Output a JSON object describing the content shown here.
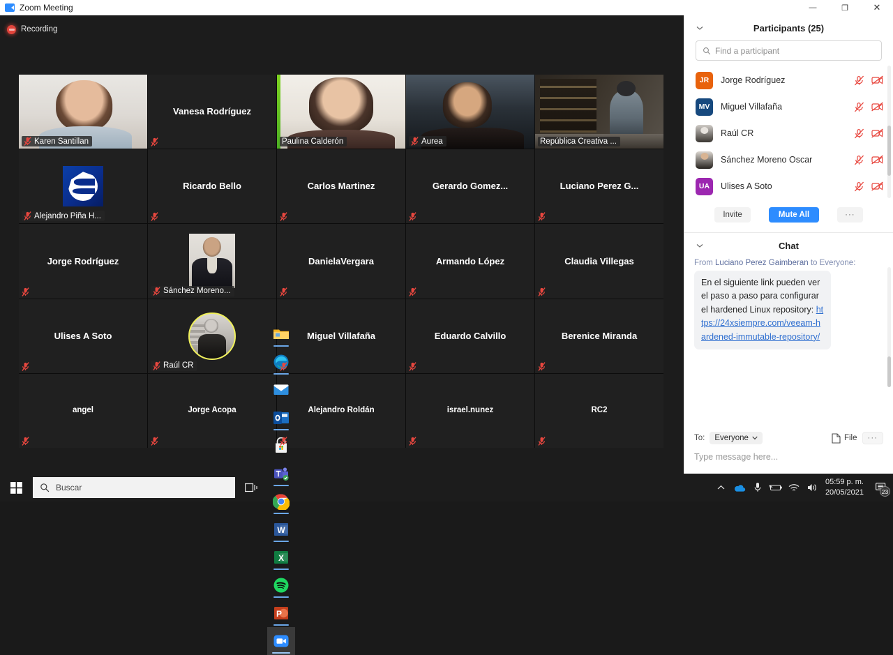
{
  "window": {
    "title": "Zoom Meeting",
    "icon": "zoom-video-icon",
    "minimize_label": "—",
    "restore_label": "❐",
    "close_label": "✕"
  },
  "meeting": {
    "recording_label": "Recording",
    "active_speaker": "Paulina Calderón",
    "tiles": [
      {
        "name": "Karen Santillan",
        "display": "corner",
        "video": "v-karen",
        "muted": true,
        "active": false
      },
      {
        "name": "Vanesa Rodríguez",
        "display": "center",
        "video": "",
        "muted": true,
        "active": false
      },
      {
        "name": "Paulina Calderón",
        "display": "corner",
        "video": "v-paulina",
        "muted": false,
        "active": true
      },
      {
        "name": "Aurea",
        "display": "corner",
        "video": "v-aurea",
        "muted": true,
        "active": false
      },
      {
        "name": "República Creativa ...",
        "display": "corner",
        "video": "v-republica",
        "muted": false,
        "active": false
      },
      {
        "name": "Alejandro Piña H...",
        "display": "corner",
        "avatar": "square-logo",
        "muted": true,
        "active": false
      },
      {
        "name": "Ricardo Bello",
        "display": "center",
        "video": "",
        "muted": true,
        "active": false
      },
      {
        "name": "Carlos Martinez",
        "display": "center",
        "video": "",
        "muted": true,
        "active": false
      },
      {
        "name": "Gerardo  Gomez...",
        "display": "center",
        "video": "",
        "muted": true,
        "active": false
      },
      {
        "name": "Luciano  Perez G...",
        "display": "center",
        "video": "",
        "muted": true,
        "active": false
      },
      {
        "name": "Jorge Rodríguez",
        "display": "center",
        "video": "",
        "muted": true,
        "active": false
      },
      {
        "name": "Sánchez Moreno...",
        "display": "corner",
        "avatar": "square-photo",
        "muted": true,
        "active": false
      },
      {
        "name": "DanielaVergara",
        "display": "center",
        "video": "",
        "muted": true,
        "active": false
      },
      {
        "name": "Armando López",
        "display": "center",
        "video": "",
        "muted": true,
        "active": false
      },
      {
        "name": "Claudia Villegas",
        "display": "center",
        "video": "",
        "muted": true,
        "active": false
      },
      {
        "name": "Ulises A Soto",
        "display": "center",
        "video": "",
        "muted": true,
        "active": false
      },
      {
        "name": "Raúl CR",
        "display": "corner",
        "avatar": "circle-photo",
        "muted": true,
        "active": false
      },
      {
        "name": "Miguel Villafaña",
        "display": "center",
        "video": "",
        "muted": true,
        "active": false
      },
      {
        "name": "Eduardo Calvillo",
        "display": "center",
        "video": "",
        "muted": true,
        "active": false
      },
      {
        "name": "Berenice Miranda",
        "display": "center",
        "video": "",
        "muted": true,
        "active": false
      },
      {
        "name": "angel",
        "display": "center",
        "video": "",
        "muted": true,
        "active": false
      },
      {
        "name": "Jorge Acopa",
        "display": "center",
        "video": "",
        "muted": true,
        "active": false
      },
      {
        "name": "Alejandro Roldán",
        "display": "center",
        "video": "",
        "muted": true,
        "active": false
      },
      {
        "name": "israel.nunez",
        "display": "center",
        "video": "",
        "muted": true,
        "active": false
      },
      {
        "name": "RC2",
        "display": "center",
        "video": "",
        "muted": true,
        "active": false
      }
    ]
  },
  "participants": {
    "title": "Participants (25)",
    "search_placeholder": "Find a participant",
    "search_value": "",
    "rows": [
      {
        "initials": "JR",
        "name": "Jorge Rodríguez",
        "color": "#e8620c",
        "avatar_type": "initials"
      },
      {
        "initials": "MV",
        "name": "Miguel Villafaña",
        "color": "#17497e",
        "avatar_type": "initials"
      },
      {
        "initials": "",
        "name": "Raúl CR",
        "color": "#555555",
        "avatar_type": "photo-a"
      },
      {
        "initials": "",
        "name": "Sánchez Moreno Oscar",
        "color": "#555555",
        "avatar_type": "photo-b"
      },
      {
        "initials": "UA",
        "name": "Ulises A Soto",
        "color": "#9c27b0",
        "avatar_type": "initials"
      }
    ],
    "invite_label": "Invite",
    "mute_all_label": "Mute All",
    "more_label": "···"
  },
  "chat": {
    "title": "Chat",
    "from_prefix": "From ",
    "from_name": "Luciano Perez Gaimberan",
    "from_suffix": " to Everyone:",
    "message_text": "En el siguiente link pueden ver el paso a paso para configurar el hardened Linux repository:",
    "message_link": "https://24xsiempre.com/veeam-hardened-immutable-repository/",
    "to_label": "To:",
    "to_value": "Everyone",
    "file_label": "File",
    "more_label": "···",
    "input_placeholder": "Type message here..."
  },
  "taskbar": {
    "start_label": "start-icon",
    "search_placeholder": "Buscar",
    "taskview_label": "task-view-icon",
    "apps": [
      {
        "name": "file-explorer",
        "open": true,
        "active": false
      },
      {
        "name": "microsoft-edge",
        "open": true,
        "active": false
      },
      {
        "name": "mail",
        "open": false,
        "active": false
      },
      {
        "name": "outlook",
        "open": true,
        "active": false
      },
      {
        "name": "microsoft-store",
        "open": false,
        "active": false
      },
      {
        "name": "microsoft-teams",
        "open": true,
        "active": false
      },
      {
        "name": "google-chrome",
        "open": true,
        "active": false
      },
      {
        "name": "word",
        "open": true,
        "active": false
      },
      {
        "name": "excel",
        "open": true,
        "active": false
      },
      {
        "name": "spotify",
        "open": true,
        "active": false
      },
      {
        "name": "powerpoint",
        "open": true,
        "active": false
      },
      {
        "name": "zoom",
        "open": true,
        "active": true
      }
    ],
    "tray": {
      "chevron": "show-hidden-icons",
      "onedrive": "onedrive-icon",
      "microphone": "microphone-icon",
      "battery": "battery-icon",
      "wifi": "wifi-icon",
      "volume": "volume-icon",
      "time": "05:59 p. m.",
      "date": "20/05/2021",
      "notification_count": "23"
    }
  },
  "colors": {
    "accent": "#2d8cff",
    "recording": "#e2443b",
    "muted": "#e8473f",
    "active_border": "#f0f05a",
    "speaking": "#7ed321"
  }
}
